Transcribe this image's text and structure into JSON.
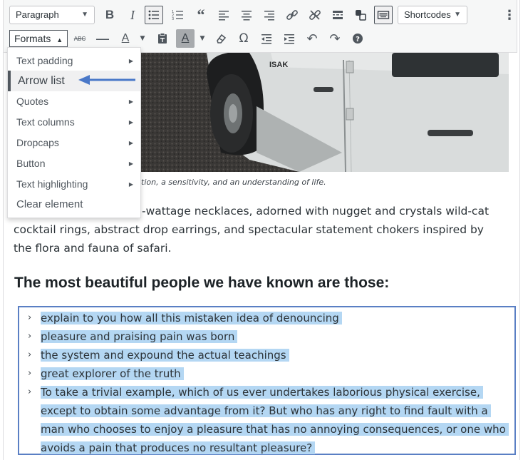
{
  "toolbar": {
    "row1": {
      "format_select": "Paragraph",
      "shortcodes_select": "Shortcodes",
      "buttons": [
        "bold-icon",
        "italic-icon",
        "bullet-list-icon",
        "numbered-list-icon",
        "blockquote-icon",
        "align-left-icon",
        "align-center-icon",
        "align-right-icon",
        "link-icon",
        "unlink-icon",
        "read-more-icon",
        "toolbar-toggle-icon",
        "keyboard-icon",
        "more-vertical-icon"
      ]
    },
    "row2": {
      "formats_label": "Formats",
      "buttons": [
        "strikethrough-icon",
        "horizontal-line-icon",
        "text-color-icon",
        "paste-text-icon",
        "background-color-icon",
        "clear-formatting-icon",
        "special-character-icon",
        "outdent-icon",
        "indent-icon",
        "undo-icon",
        "redo-icon",
        "help-icon"
      ]
    }
  },
  "formats_menu": {
    "items": [
      {
        "label": "Text padding",
        "has_submenu": true
      },
      {
        "label": "Arrow list",
        "has_submenu": false,
        "active": true
      },
      {
        "label": "Quotes",
        "has_submenu": true
      },
      {
        "label": "Text columns",
        "has_submenu": true
      },
      {
        "label": "Dropcaps",
        "has_submenu": true
      },
      {
        "label": "Button",
        "has_submenu": true
      },
      {
        "label": "Text highlighting",
        "has_submenu": true
      },
      {
        "label": "Clear element",
        "has_submenu": false
      }
    ],
    "callout_color": "#4a78c8"
  },
  "content": {
    "caption": "tion, a sensitivity, and an understanding of life.",
    "paragraph_first": "-wattage necklaces, adorned with nugget and crystals wild-cat",
    "paragraph_rest": "cocktail rings, abstract drop earrings, and spectacular statement chokers inspired by the flora and fauna of safari.",
    "heading": "The most beautiful people we have known are those:",
    "list_items": [
      "explain to you how all this mistaken idea of denouncing",
      "pleasure and praising pain was born",
      "the system and expound the actual teachings",
      "great explorer of the truth",
      "To take a trivial example, which of us ever undertakes laborious physical exercise, except to obtain some advantage from it? But who has any right to find fault with a man who chooses to enjoy a pleasure that has no annoying consequences, or one who avoids a pain that produces no resultant pleasure?"
    ],
    "selection_color": "#b4d7f3",
    "list_border_color": "#5a7fc4"
  }
}
